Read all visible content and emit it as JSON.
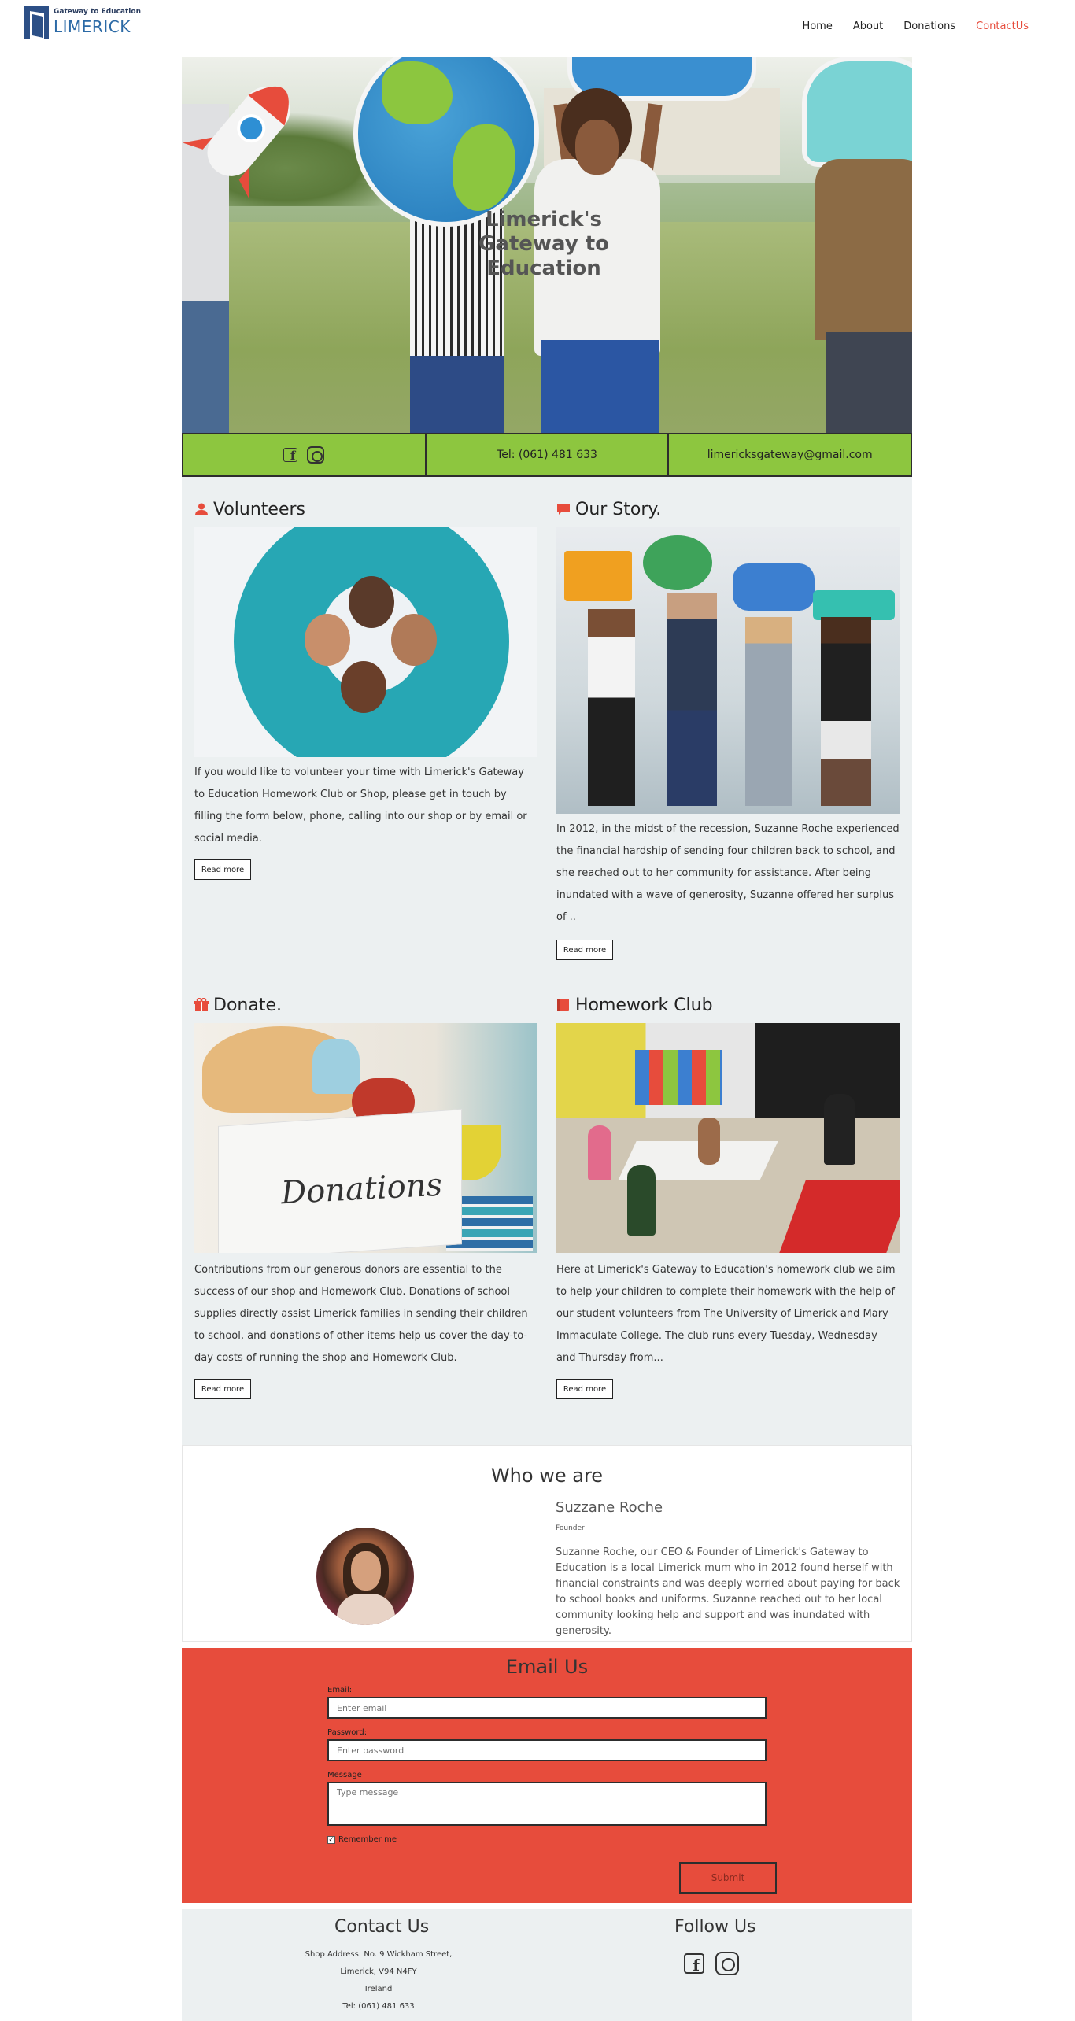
{
  "nav": {
    "logo_small": "Gateway to Education",
    "logo_big": "LIMERICK",
    "links": [
      {
        "label": "Home"
      },
      {
        "label": "About"
      },
      {
        "label": "Donations"
      },
      {
        "label": "ContactUs"
      }
    ],
    "active_color": "#e74c3c"
  },
  "hero": {
    "title": "Limerick's Gateway to Education"
  },
  "infobar": {
    "phone": "Tel: (061) 481 633",
    "email": "limericksgateway@gmail.com",
    "social_icons": [
      "facebook-icon",
      "instagram-icon"
    ],
    "color": "#8dc63f"
  },
  "cards": {
    "volunteers": {
      "title": "Volunteers",
      "icon": "user-icon",
      "text": "If you would like to volunteer your time with Limerick's Gateway to Education Homework Club or Shop, please get in touch by filling the form below, phone, calling into our shop or by email or social media.",
      "button": "Read more"
    },
    "story": {
      "title": "Our Story.",
      "icon": "comment-icon",
      "text": "In 2012, in the midst of the recession, Suzanne Roche experienced the financial hardship of sending four children back to school, and she reached out to her community for assistance. After being inundated with a wave of generosity, Suzanne offered her surplus of ..",
      "button": "Read more"
    },
    "donate": {
      "title": "Donate.",
      "icon": "gift-icon",
      "image_text": "Donations",
      "text": "Contributions from our generous donors are essential to the success of our shop and Homework Club. Donations of school supplies directly assist Limerick families in sending their children to school, and donations of other items help us cover the day-to-day costs of running the shop and Homework Club.",
      "button": "Read more"
    },
    "homework": {
      "title": "Homework Club",
      "icon": "book-icon",
      "text": "Here at Limerick's Gateway to Education's homework club we aim to help your children to complete their homework with the help of our student volunteers from The University of Limerick and Mary Immaculate College. The club runs every Tuesday, Wednesday and Thursday from...",
      "button": "Read more"
    },
    "icon_color": "#e74c3c"
  },
  "who": {
    "title": "Who we are",
    "name": "Suzzane Roche",
    "role": "Founder",
    "description": "Suzanne Roche, our CEO & Founder of Limerick's Gateway to Education is a local Limerick mum who in 2012 found herself with financial constraints and was deeply worried about paying for back to school books and uniforms. Suzanne reached out to her local community looking help and support and was inundated with generosity."
  },
  "email_form": {
    "title": "Email Us",
    "email_label": "Email:",
    "email_placeholder": "Enter email",
    "password_label": "Password:",
    "password_placeholder": "Enter password",
    "message_label": "Message",
    "message_placeholder": "Type message",
    "remember_label": "Remember me",
    "remember_checked": true,
    "submit_label": "Submit",
    "bg_color": "#e74c3c"
  },
  "footer": {
    "contact_title": "Contact Us",
    "address_line1": "Shop Address: No. 9 Wickham Street,",
    "address_line2": "Limerick, V94 N4FY",
    "address_line3": "Ireland",
    "phone": "Tel: (061) 481 633",
    "follow_title": "Follow Us",
    "social_icons": [
      "facebook-icon",
      "instagram-icon"
    ]
  }
}
